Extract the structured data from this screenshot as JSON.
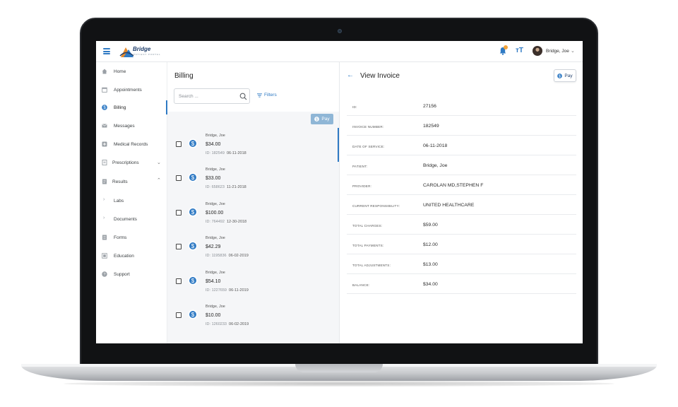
{
  "header": {
    "logo_text": "Bridge",
    "logo_subtext": "PATIENT PORTAL",
    "notification_count": "1",
    "user_name": "Bridge, Joe"
  },
  "sidebar": {
    "items": [
      {
        "label": "Home",
        "icon": "home-icon"
      },
      {
        "label": "Appointments",
        "icon": "calendar-icon"
      },
      {
        "label": "Billing",
        "icon": "dollar-circle-icon",
        "active": true
      },
      {
        "label": "Messages",
        "icon": "mail-icon"
      },
      {
        "label": "Medical Records",
        "icon": "medical-cross-icon"
      },
      {
        "label": "Prescriptions",
        "icon": "prescription-icon",
        "expandable": true
      },
      {
        "label": "Results",
        "icon": "results-icon",
        "expanded": true
      },
      {
        "label": "Labs",
        "icon": "chevron-right-icon"
      },
      {
        "label": "Documents",
        "icon": "chevron-right-icon"
      },
      {
        "label": "Forms",
        "icon": "forms-icon"
      },
      {
        "label": "Education",
        "icon": "education-icon"
      },
      {
        "label": "Support",
        "icon": "help-icon"
      }
    ]
  },
  "billing": {
    "title": "Billing",
    "search_placeholder": "Search ...",
    "filters_label": "Filters",
    "pay_label": "Pay",
    "id_label": "ID:",
    "rows": [
      {
        "patient": "Bridge, Joe",
        "amount": "$34.00",
        "id": "182549",
        "date": "06-11-2018"
      },
      {
        "patient": "Bridge, Joe",
        "amount": "$33.00",
        "id": "658623",
        "date": "11-21-2018"
      },
      {
        "patient": "Bridge, Joe",
        "amount": "$100.00",
        "id": "764492",
        "date": "12-30-2018"
      },
      {
        "patient": "Bridge, Joe",
        "amount": "$42.29",
        "id": "1195836",
        "date": "06-02-2019"
      },
      {
        "patient": "Bridge, Joe",
        "amount": "$54.10",
        "id": "1227659",
        "date": "06-11-2019"
      },
      {
        "patient": "Bridge, Joe",
        "amount": "$10.00",
        "id": "1260233",
        "date": "06-02-2019"
      }
    ]
  },
  "invoice": {
    "title": "View Invoice",
    "pay_label": "Pay",
    "fields": [
      {
        "label": "ID:",
        "value": "27156"
      },
      {
        "label": "INVOICE NUMBER:",
        "value": "182549"
      },
      {
        "label": "DATE OF SERVICE:",
        "value": "06-11-2018"
      },
      {
        "label": "PATIENT:",
        "value": "Bridge, Joe"
      },
      {
        "label": "PROVIDER:",
        "value": "CAROLAN MD,STEPHEN F"
      },
      {
        "label": "CURRENT RESPONSIBILITY:",
        "value": "UNITED HEALTHCARE"
      },
      {
        "label": "TOTAL CHARGES:",
        "value": "$59.00"
      },
      {
        "label": "TOTAL PAYMENTS:",
        "value": "$12.00"
      },
      {
        "label": "TOTAL ADJUSTMENTS:",
        "value": "$13.00"
      },
      {
        "label": "BALANCE:",
        "value": "$34.00"
      }
    ]
  },
  "colors": {
    "accent": "#2f7ac4",
    "brand_dark": "#1f3e6b",
    "badge": "#f2a33a",
    "pay_disabled": "#8fb6d6"
  }
}
